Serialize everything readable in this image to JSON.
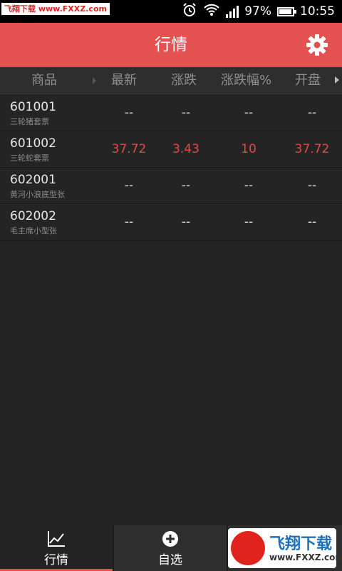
{
  "status_bar": {
    "watermark": "飞翔下载 www.FXXZ.com",
    "battery": "97%",
    "time": "10:55"
  },
  "header": {
    "title": "行情",
    "settings_icon": "gear-icon"
  },
  "columns": [
    "商品",
    "最新",
    "涨跌",
    "涨跌幅%",
    "开盘"
  ],
  "rows": [
    {
      "code": "601001",
      "name": "三轮猪套票",
      "latest": "--",
      "change": "--",
      "change_pct": "--",
      "open": "--",
      "highlight": false
    },
    {
      "code": "601002",
      "name": "三轮蛇套票",
      "latest": "37.72",
      "change": "3.43",
      "change_pct": "10",
      "open": "37.72",
      "highlight": true
    },
    {
      "code": "602001",
      "name": "黄河小浪底型张",
      "latest": "--",
      "change": "--",
      "change_pct": "--",
      "open": "--",
      "highlight": false
    },
    {
      "code": "602002",
      "name": "毛主席小型张",
      "latest": "--",
      "change": "--",
      "change_pct": "--",
      "open": "--",
      "highlight": false
    }
  ],
  "tabs": [
    {
      "label": "行情",
      "icon": "chart-icon"
    },
    {
      "label": "自选",
      "icon": "add-circle-icon"
    }
  ],
  "logo": {
    "name": "飞翔下载",
    "url": "www.FXXZ.com"
  },
  "colors": {
    "accent": "#e35250",
    "rise": "#e04a45",
    "background": "#232323"
  }
}
